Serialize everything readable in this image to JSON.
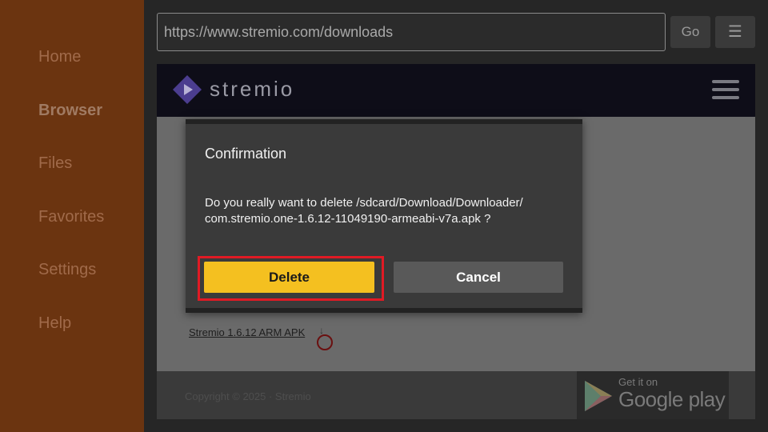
{
  "sidebar": {
    "items": [
      {
        "label": "Home",
        "active": false
      },
      {
        "label": "Browser",
        "active": true
      },
      {
        "label": "Files",
        "active": false
      },
      {
        "label": "Favorites",
        "active": false
      },
      {
        "label": "Settings",
        "active": false
      },
      {
        "label": "Help",
        "active": false
      }
    ]
  },
  "toolbar": {
    "url": "https://www.stremio.com/downloads",
    "go_label": "Go",
    "menu_icon": "menu-icon"
  },
  "site": {
    "logo_text": "stremio",
    "apk_link": "Stremio 1.6.12 ARM APK",
    "copyright": "Copyright © 2025 · Stremio",
    "gplay_small": "Get it on",
    "gplay_big": "Google play"
  },
  "dialog": {
    "title": "Confirmation",
    "message_line1": "Do you really want to delete /sdcard/Download/Downloader/",
    "message_line2": "com.stremio.one-1.6.12-11049190-armeabi-v7a.apk ?",
    "delete_label": "Delete",
    "cancel_label": "Cancel"
  },
  "colors": {
    "sidebar_bg": "#6b3410",
    "delete_button": "#f4c020",
    "focus_ring": "#e01a24",
    "cancel_button": "#595959"
  }
}
